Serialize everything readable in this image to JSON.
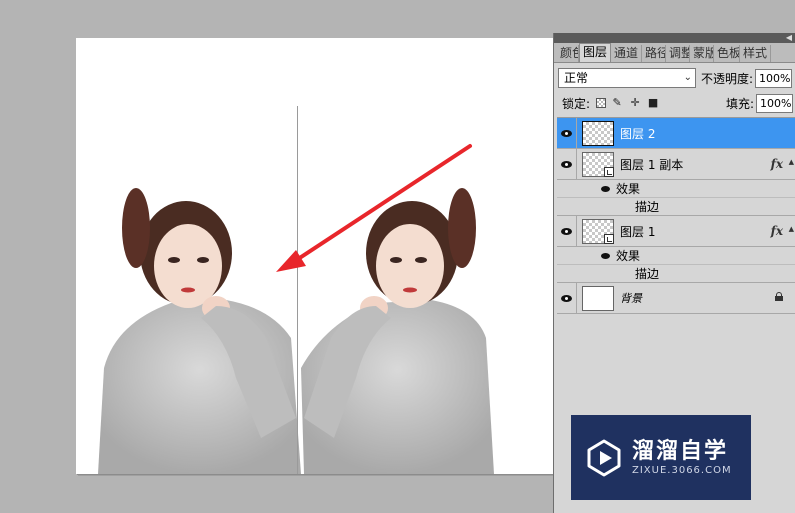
{
  "panel": {
    "tabs": [
      {
        "label": "颜色",
        "active": false
      },
      {
        "label": "图层",
        "active": true
      },
      {
        "label": "通道",
        "active": false
      },
      {
        "label": "路径",
        "active": false
      },
      {
        "label": "调整",
        "active": false
      },
      {
        "label": "蒙版",
        "active": false
      },
      {
        "label": "色板",
        "active": false
      },
      {
        "label": "样式",
        "active": false
      }
    ],
    "blend_mode": "正常",
    "opacity_label": "不透明度:",
    "opacity_value": "100%",
    "lock_label": "锁定:",
    "fill_label": "填充:",
    "fill_value": "100%",
    "fx_label": "fx",
    "layers": [
      {
        "name": "图层 2",
        "selected": true
      },
      {
        "name": "图层 1 副本",
        "effects_label": "效果",
        "effect": "描边"
      },
      {
        "name": "图层 1",
        "effects_label": "效果",
        "effect": "描边"
      },
      {
        "name": "背景",
        "locked": true
      }
    ]
  },
  "watermark": {
    "title": "溜溜自学",
    "url": "ZIXUE.3066.COM"
  },
  "colors": {
    "selection": "#3d95f0",
    "arrow": "#e8262b",
    "watermark_bg": "#1f3160"
  }
}
